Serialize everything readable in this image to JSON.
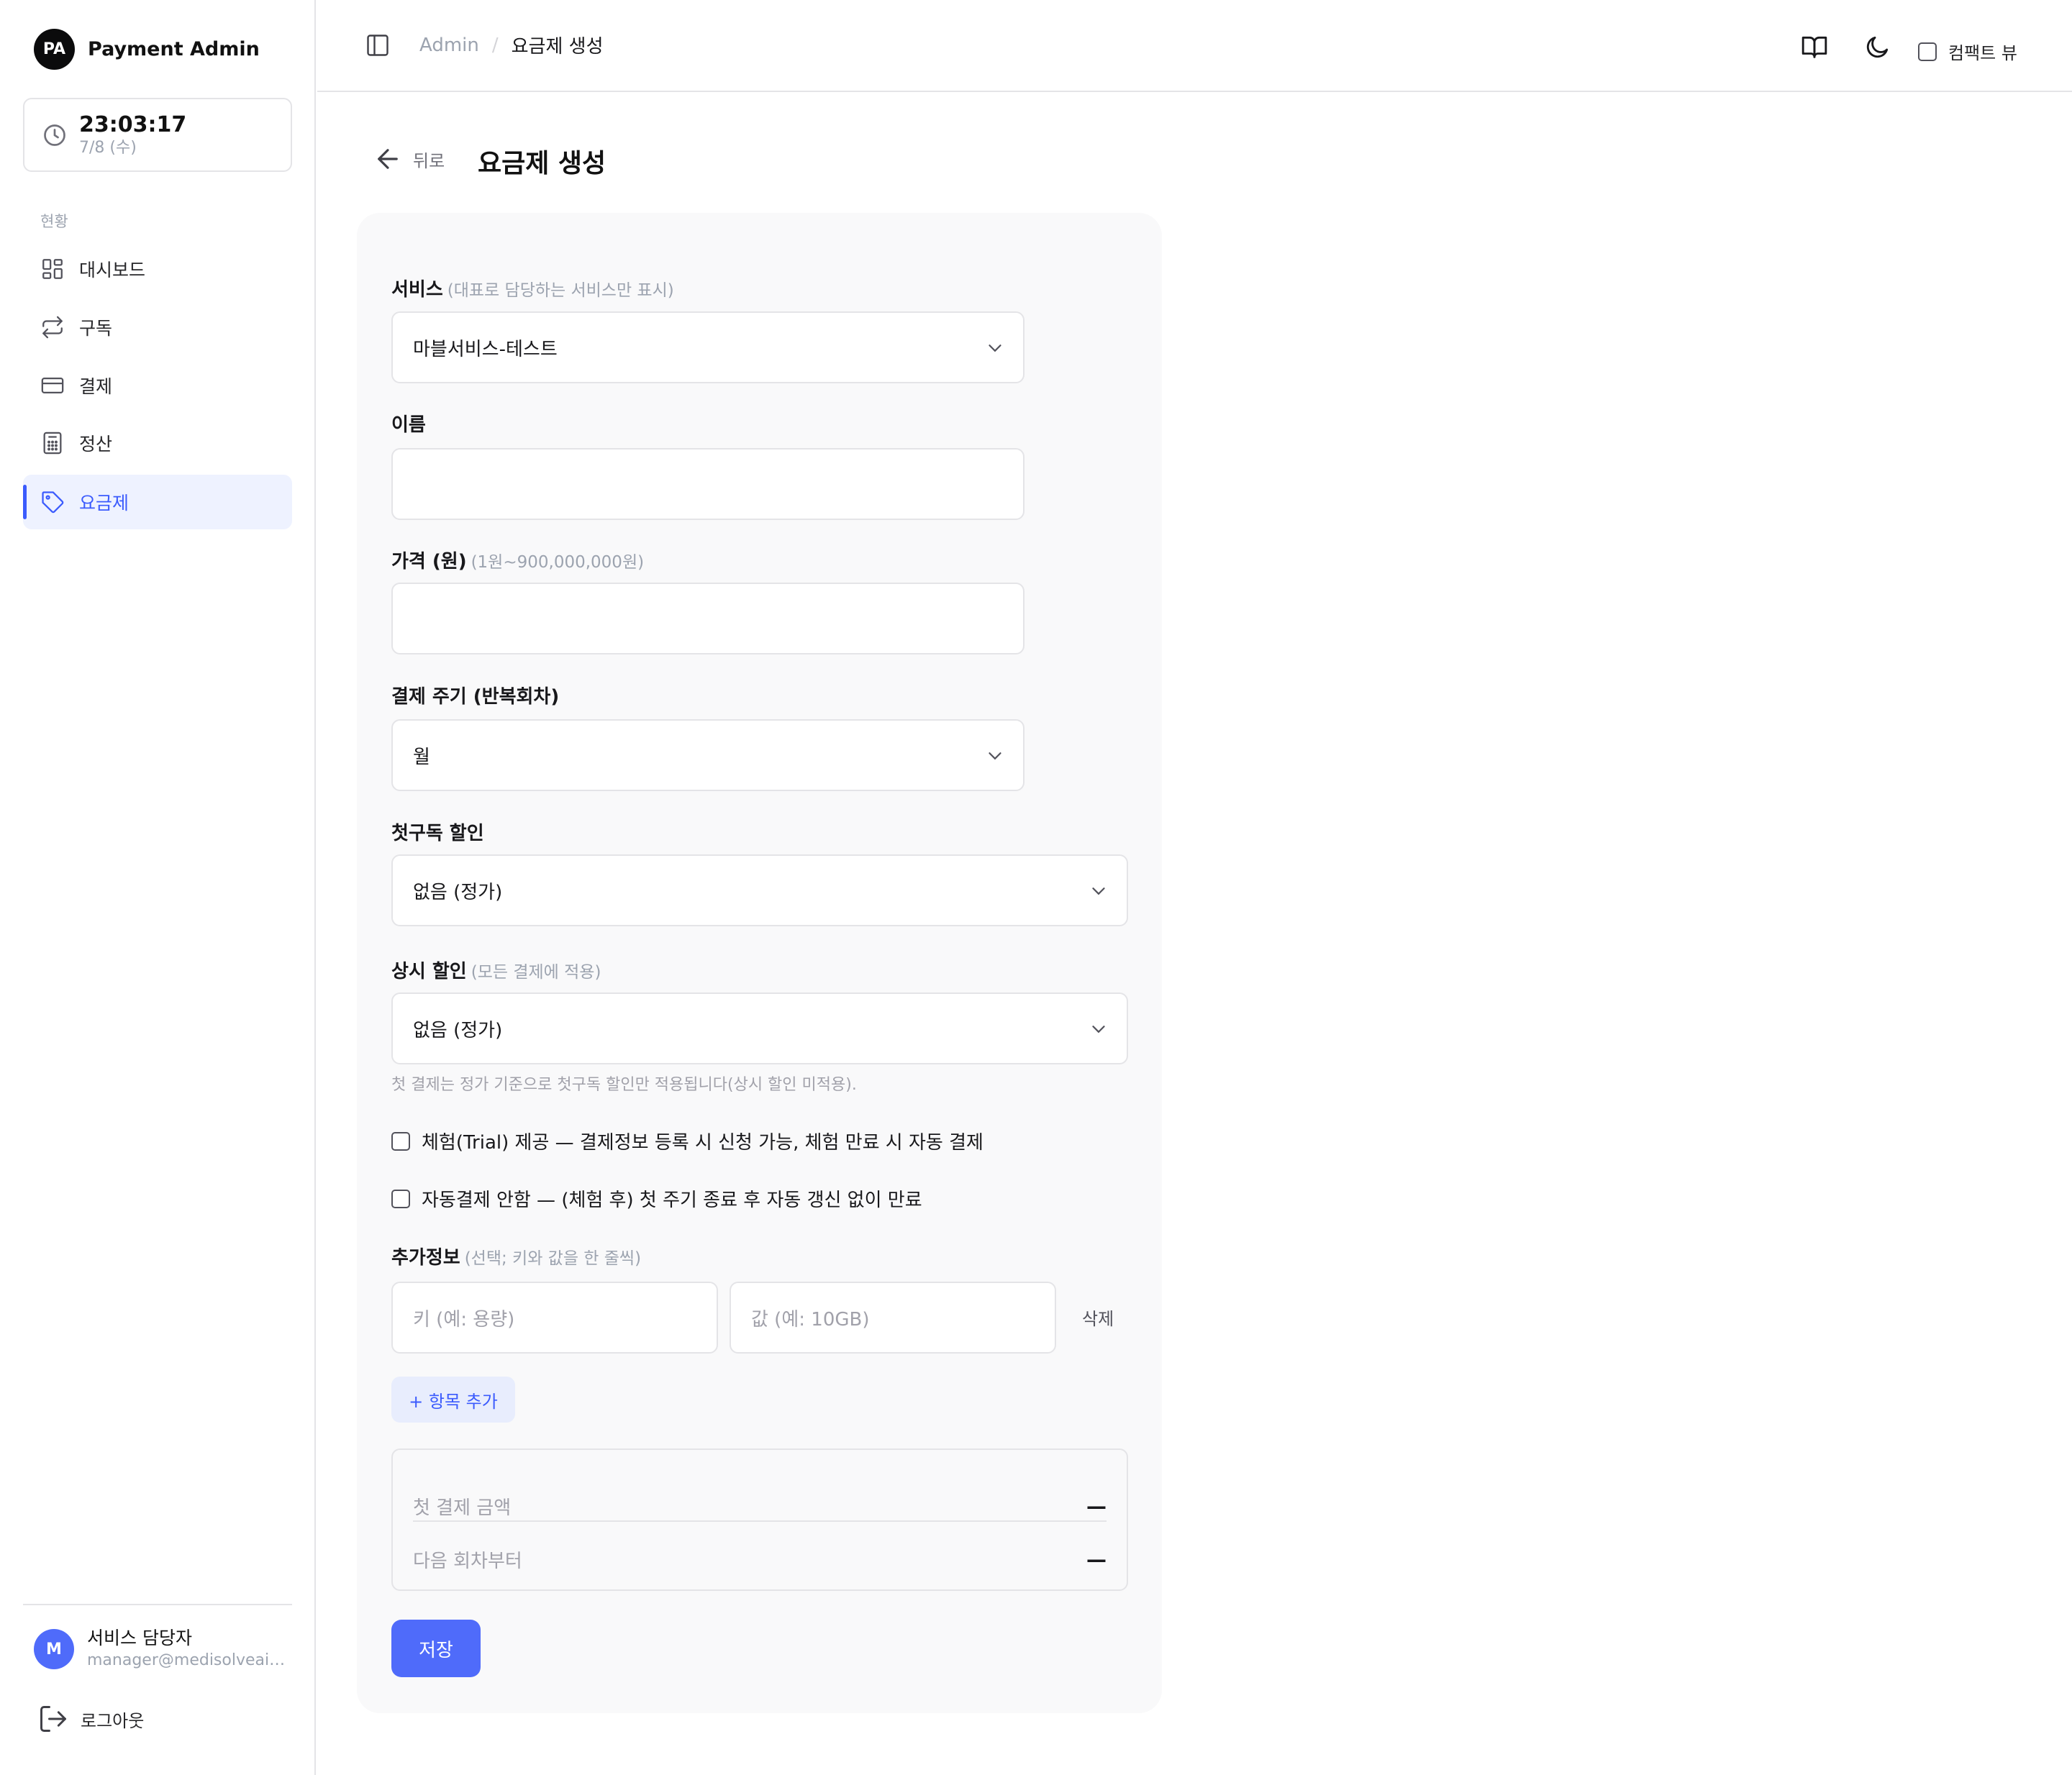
{
  "brand": {
    "logo_text": "PA",
    "name": "Payment Admin"
  },
  "clock": {
    "time": "23:03:17",
    "date": "7/8 (수)"
  },
  "sidebar": {
    "section_label": "현황",
    "items": [
      {
        "label": "대시보드",
        "icon": "dashboard-grid-icon"
      },
      {
        "label": "구독",
        "icon": "repeat-arrows-icon"
      },
      {
        "label": "결제",
        "icon": "credit-card-icon"
      },
      {
        "label": "정산",
        "icon": "calculator-icon"
      },
      {
        "label": "요금제",
        "icon": "tag-icon",
        "active": true
      }
    ],
    "user": {
      "avatar_initial": "M",
      "name": "서비스 담당자",
      "email": "manager@medisolveai...."
    },
    "logout_label": "로그아웃"
  },
  "topbar": {
    "breadcrumb_root": "Admin",
    "breadcrumb_sep": "/",
    "breadcrumb_current": "요금제 생성",
    "compact_view_label": "컴팩트 뷰",
    "icons": [
      "sidebar-toggle-icon",
      "book-icon",
      "moon-icon"
    ]
  },
  "page": {
    "back_label": "뒤로",
    "title": "요금제 생성"
  },
  "form": {
    "service": {
      "label": "서비스",
      "hint": "(대표로 담당하는 서비스만 표시)",
      "value": "마블서비스-테스트"
    },
    "name": {
      "label": "이름",
      "value": ""
    },
    "price": {
      "label": "가격 (원)",
      "hint": "(1원~900,000,000원)",
      "value": ""
    },
    "cycle": {
      "label": "결제 주기 (반복회차)",
      "value": "월"
    },
    "first_discount": {
      "label": "첫구독 할인",
      "value": "없음 (정가)"
    },
    "regular_discount": {
      "label": "상시 할인",
      "hint": "(모든 결제에 적용)",
      "value": "없음 (정가)"
    },
    "helper_text": "첫 결제는 정가 기준으로 첫구독 할인만 적용됩니다(상시 할인 미적용).",
    "trial_checkbox": "체험(Trial) 제공 — 결제정보 등록 시 신청 가능, 체험 만료 시 자동 결제",
    "no_autopay_checkbox": "자동결제 안함 — (체험 후) 첫 주기 종료 후 자동 갱신 없이 만료",
    "extra": {
      "label": "추가정보",
      "hint": "(선택; 키와 값을 한 줄씩)",
      "key_placeholder": "키 (예: 용량)",
      "value_placeholder": "값 (예: 10GB)",
      "delete_label": "삭제",
      "add_label": "+ 항목 추가"
    },
    "summary": {
      "first_payment_label": "첫 결제 금액",
      "first_payment_value": "—",
      "next_label": "다음 회차부터",
      "next_value": "—"
    },
    "save_label": "저장"
  },
  "colors": {
    "accent": "#4f6bfa",
    "active_bg": "#eef2ff",
    "card_bg": "#f9f9fa",
    "border": "#e4e4e7"
  }
}
